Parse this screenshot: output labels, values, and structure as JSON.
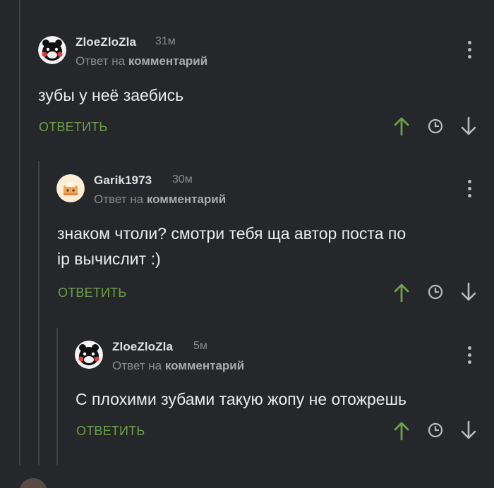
{
  "comments": [
    {
      "author": "ZloeZloZla",
      "time": "31м",
      "reply_prefix": "Ответ на",
      "reply_target": "комментарий",
      "text_lines": [
        "зубы у неё заебись"
      ],
      "reply_label": "ОТВЕТИТЬ"
    },
    {
      "author": "Garik1973",
      "time": "30м",
      "reply_prefix": "Ответ на",
      "reply_target": "комментарий",
      "text_lines": [
        "знаком чтоли? смотри тебя ща автор поста по",
        "ip вычислит :)"
      ],
      "reply_label": "ОТВЕТИТЬ"
    },
    {
      "author": "ZloeZloZla",
      "time": "5м",
      "reply_prefix": "Ответ на",
      "reply_target": "комментарий",
      "text_lines": [
        "С плохими зубами такую жопу не отожрешь"
      ],
      "reply_label": "ОТВЕТИТЬ"
    }
  ],
  "colors": {
    "background": "#25272a",
    "accent_green": "#6fa04c",
    "muted_text": "#8a8c8f",
    "thread_line": "#3e4144"
  },
  "icons": [
    "kebab-menu-icon",
    "arrow-up-icon",
    "clock-icon",
    "arrow-down-icon"
  ]
}
